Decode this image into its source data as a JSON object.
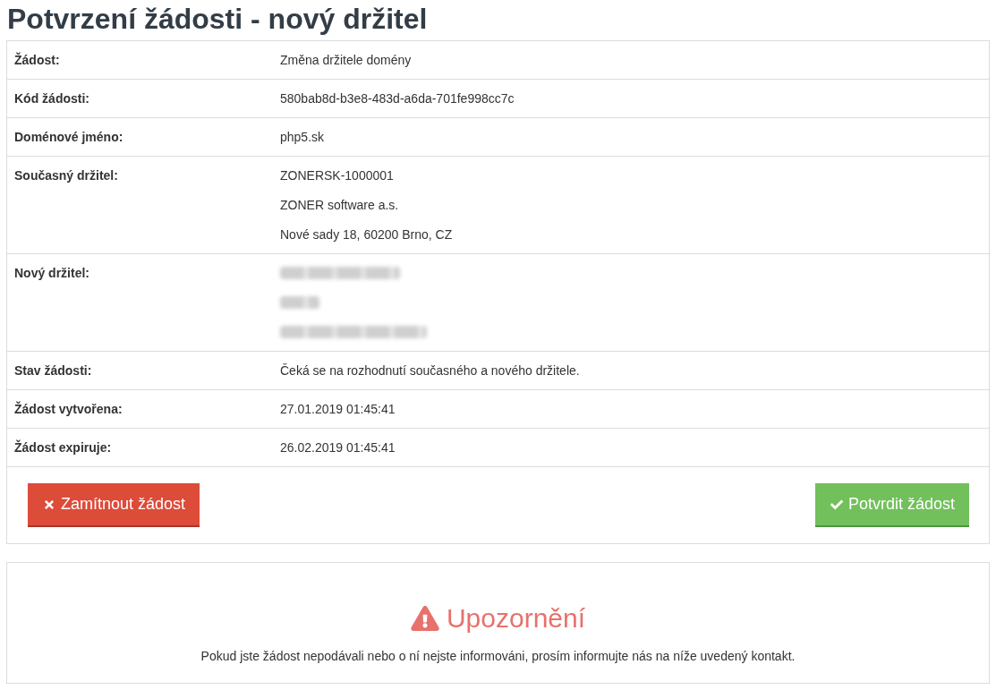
{
  "page": {
    "title": "Potvrzení žádosti - nový držitel"
  },
  "details": {
    "rows": [
      {
        "label": "Žádost:",
        "lines": [
          {
            "kind": "text",
            "text": "Změna držitele domény"
          }
        ]
      },
      {
        "label": "Kód žádosti:",
        "lines": [
          {
            "kind": "text",
            "text": "580bab8d-b3e8-483d-a6da-701fe998cc7c"
          }
        ]
      },
      {
        "label": "Doménové jméno:",
        "lines": [
          {
            "kind": "text",
            "text": "php5.sk"
          }
        ]
      },
      {
        "label": "Současný držitel:",
        "lines": [
          {
            "kind": "text",
            "text": "ZONERSK-1000001"
          },
          {
            "kind": "text",
            "text": "ZONER software a.s."
          },
          {
            "kind": "text",
            "text": "Nové sady 18, 60200 Brno, CZ"
          }
        ]
      },
      {
        "label": "Nový držitel:",
        "lines": [
          {
            "kind": "redacted"
          },
          {
            "kind": "redacted"
          },
          {
            "kind": "redacted"
          }
        ]
      },
      {
        "label": "Stav žádosti:",
        "lines": [
          {
            "kind": "text",
            "text": "Čeká se na rozhodnutí současného a nového držitele."
          }
        ]
      },
      {
        "label": "Žádost vytvořena:",
        "lines": [
          {
            "kind": "text",
            "text": "27.01.2019 01:45:41"
          }
        ]
      },
      {
        "label": "Žádost expiruje:",
        "lines": [
          {
            "kind": "text",
            "text": "26.02.2019 01:45:41"
          }
        ]
      }
    ]
  },
  "actions": [
    {
      "kind": "reject",
      "label": "Zamítnout žádost"
    },
    {
      "kind": "confirm",
      "label": "Potvrdit žádost"
    }
  ],
  "warning": {
    "title": "Upozornění",
    "text": "Pokud jste žádost nepodávali nebo o ní nejste informováni, prosím informujte nás na níže uvedený kontakt."
  }
}
